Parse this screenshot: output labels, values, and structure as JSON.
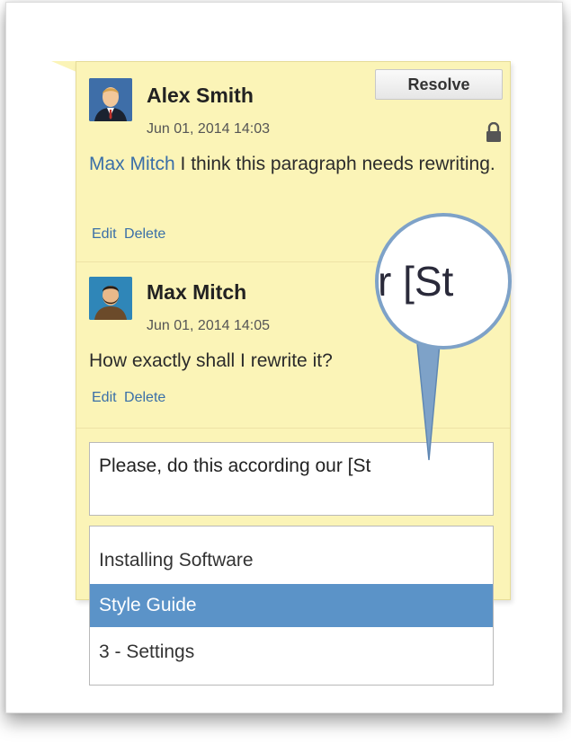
{
  "comments": [
    {
      "author": "Alex Smith",
      "date": "Jun 01, 2014 14:03",
      "mention": "Max Mitch",
      "text": " I think this paragraph needs rewriting.",
      "edit_label": "Edit",
      "delete_label": "Delete"
    },
    {
      "author": "Max Mitch",
      "date": "Jun 01, 2014 14:05",
      "text": "How exactly shall I rewrite it?",
      "edit_label": "Edit",
      "delete_label": "Delete"
    }
  ],
  "resolve_label": "Resolve",
  "reply": {
    "value": "Please, do this according our [St"
  },
  "magnifier": {
    "text": "r [St"
  },
  "suggestions": {
    "items": [
      "Installing Software",
      "Style Guide",
      "3 - Settings"
    ],
    "selected_index": 1
  },
  "colors": {
    "panel": "#fbf4b7",
    "link": "#3a6fa8",
    "selected": "#5b93c8"
  },
  "icons": [
    "lock-icon",
    "user-avatar",
    "magnifier-lens"
  ]
}
